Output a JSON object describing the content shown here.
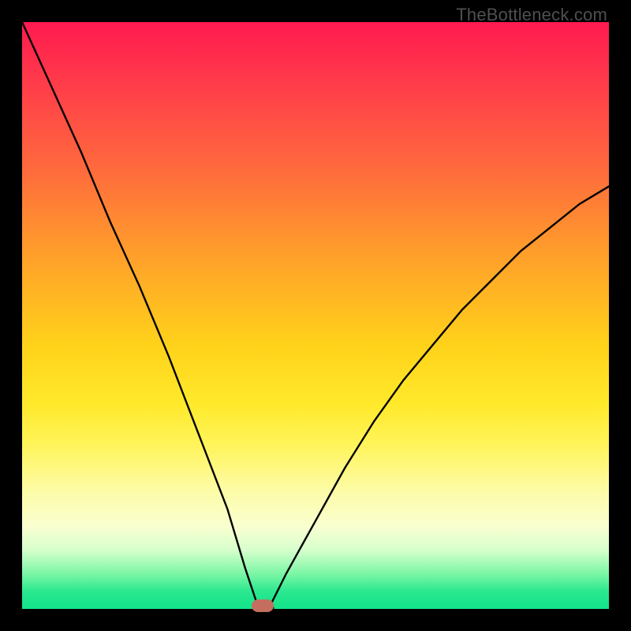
{
  "watermark": "TheBottleneck.com",
  "chart_data": {
    "type": "line",
    "title": "",
    "xlabel": "",
    "ylabel": "",
    "xlim": [
      0,
      100
    ],
    "ylim": [
      0,
      100
    ],
    "grid": false,
    "legend": false,
    "series": [
      {
        "name": "bottleneck-curve",
        "x": [
          0,
          5,
          10,
          15,
          20,
          25,
          30,
          35,
          38,
          40,
          41,
          42,
          45,
          50,
          55,
          60,
          65,
          70,
          75,
          80,
          85,
          90,
          95,
          100
        ],
        "values": [
          100,
          89,
          78,
          66,
          55,
          43,
          30,
          17,
          7,
          1,
          0,
          0,
          6,
          15,
          24,
          32,
          39,
          45,
          51,
          56,
          61,
          65,
          69,
          72
        ]
      }
    ],
    "annotations": [
      {
        "name": "optimal-point",
        "x": 41,
        "y": 0.5
      }
    ],
    "background_gradient": {
      "top": "#ff1a50",
      "mid": "#ffe92a",
      "bottom": "#12e38a"
    }
  }
}
